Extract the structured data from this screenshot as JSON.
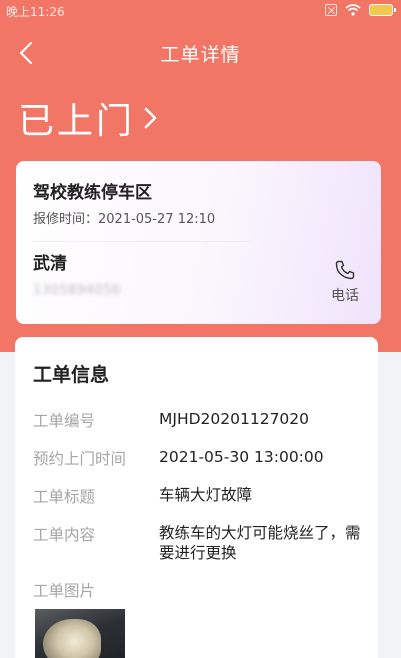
{
  "status_bar": {
    "time": "晚上11:26"
  },
  "nav": {
    "title": "工单详情"
  },
  "status_heading": "已上门",
  "contact_card": {
    "location": "驾校教练停车区",
    "report_time_label": "报修时间：",
    "report_time": "2021-05-27 12:10",
    "person_name": "武清",
    "phone_masked": "1305894056",
    "call_label": "电话"
  },
  "info": {
    "section_title": "工单信息",
    "rows": [
      {
        "label": "工单编号",
        "value": "MJHD20201127020"
      },
      {
        "label": "预约上门时间",
        "value": "2021-05-30 13:00:00"
      },
      {
        "label": "工单标题",
        "value": "车辆大灯故障"
      },
      {
        "label": "工单内容",
        "value": "教练车的大灯可能烧丝了，需要进行更换"
      }
    ],
    "images_label": "工单图片"
  },
  "colors": {
    "accent": "#f27665",
    "background": "#f2f3f7"
  }
}
